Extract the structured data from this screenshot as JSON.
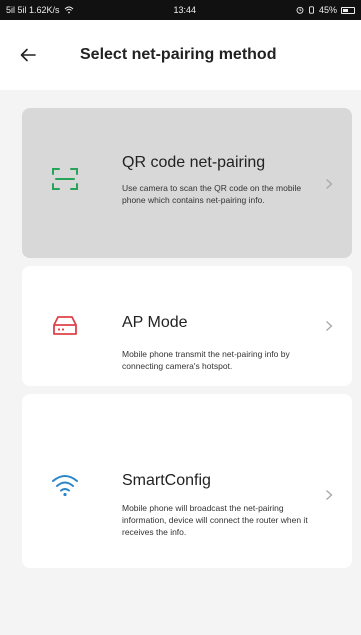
{
  "status_bar": {
    "left": "5il 5il 1.62K/s",
    "time": "13:44",
    "battery": "45%"
  },
  "header": {
    "title": "Select net-pairing method"
  },
  "options": [
    {
      "title": "QR code net-pairing",
      "description": "Use camera to scan the QR code on the mobile phone which contains net-pairing info.",
      "icon": "qr-scan-icon",
      "icon_color": "#27a35a",
      "selected": true
    },
    {
      "title": "AP Mode",
      "description": "Mobile phone transmit the net-pairing info by connecting camera's hotspot.",
      "icon": "router-icon",
      "icon_color": "#e0404a",
      "selected": false
    },
    {
      "title": "SmartConfig",
      "description": "Mobile phone will broadcast the net-pairing information, device will connect the router when it receives the info.",
      "icon": "wifi-icon",
      "icon_color": "#2a86c8",
      "selected": false
    }
  ]
}
